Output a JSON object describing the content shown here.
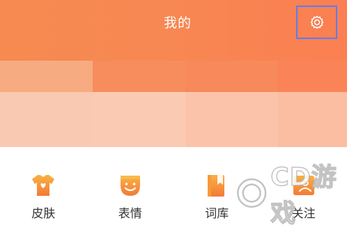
{
  "header": {
    "title": "我的",
    "settings_icon": "gear-icon",
    "highlight_color": "#5b7cf0",
    "gradient_colors": [
      "#f68a50",
      "#fb7f52"
    ]
  },
  "grid": {
    "items": [
      {
        "label": "皮肤",
        "icon": "tshirt-heart-icon"
      },
      {
        "label": "表情",
        "icon": "smiley-face-icon"
      },
      {
        "label": "词库",
        "icon": "book-icon"
      },
      {
        "label": "关注",
        "icon": "follow-card-icon"
      }
    ],
    "icon_colors": [
      "#f9b142",
      "#f47a38"
    ]
  },
  "watermark": {
    "text": "CD游戏"
  }
}
